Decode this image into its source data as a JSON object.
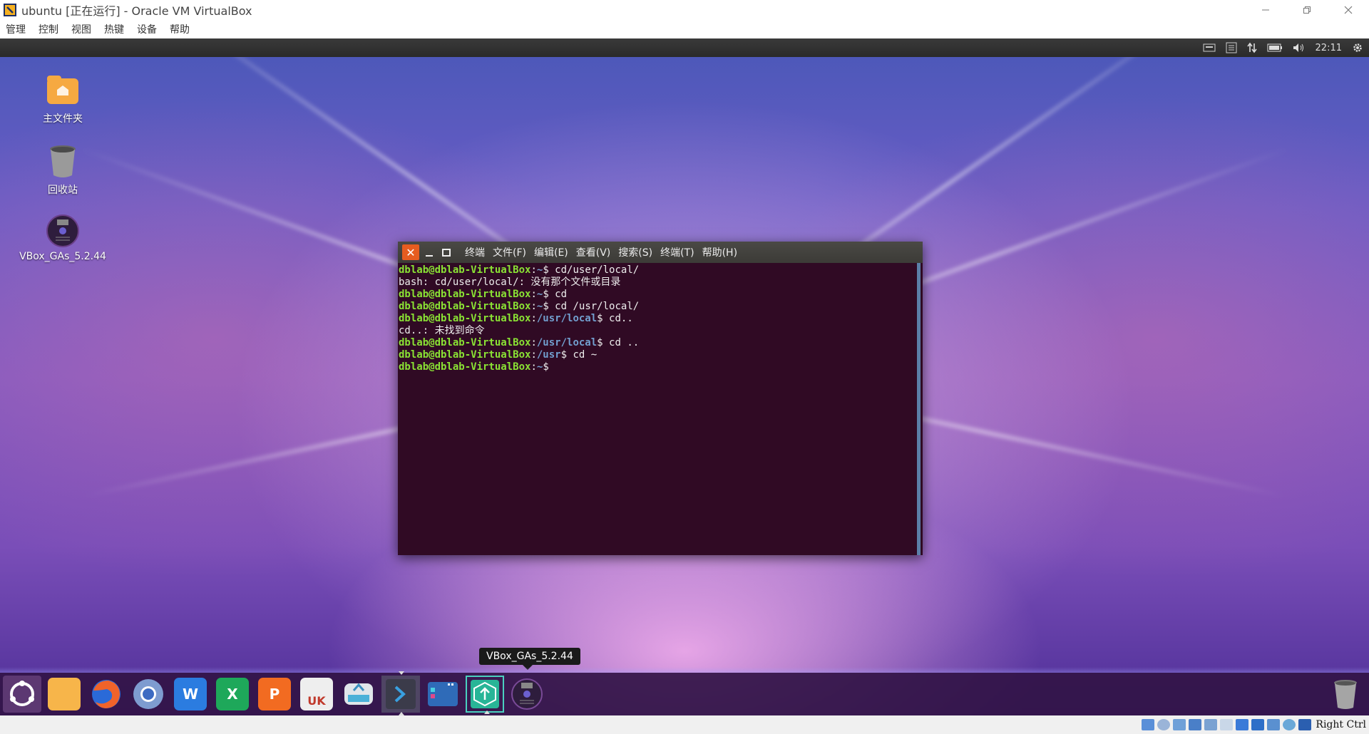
{
  "host": {
    "title": "ubuntu [正在运行] - Oracle VM VirtualBox",
    "menu": [
      "管理",
      "控制",
      "视图",
      "热键",
      "设备",
      "帮助"
    ],
    "host_key_label": "Right Ctrl"
  },
  "guest": {
    "topbar": {
      "time": "22:11"
    },
    "desktop_icons": [
      {
        "label": "主文件夹",
        "icon": "home-folder-icon"
      },
      {
        "label": "回收站",
        "icon": "trash-icon"
      },
      {
        "label": "VBox_GAs_5.2.44",
        "icon": "cd-icon"
      }
    ],
    "terminal": {
      "menus": [
        "终端",
        "文件(F)",
        "编辑(E)",
        "查看(V)",
        "搜索(S)",
        "终端(T)",
        "帮助(H)"
      ],
      "lines": [
        {
          "user": "dblab@dblab-VirtualBox",
          "path": "~",
          "cmd": "$ cd/user/local/"
        },
        {
          "text": "bash: cd/user/local/: 没有那个文件或目录"
        },
        {
          "user": "dblab@dblab-VirtualBox",
          "path": "~",
          "cmd": "$ cd"
        },
        {
          "user": "dblab@dblab-VirtualBox",
          "path": "~",
          "cmd": "$ cd /usr/local/"
        },
        {
          "user": "dblab@dblab-VirtualBox",
          "path": "/usr/local",
          "cmd": "$ cd.."
        },
        {
          "text": "cd..: 未找到命令"
        },
        {
          "user": "dblab@dblab-VirtualBox",
          "path": "/usr/local",
          "cmd": "$ cd .."
        },
        {
          "user": "dblab@dblab-VirtualBox",
          "path": "/usr",
          "cmd": "$ cd ~"
        },
        {
          "user": "dblab@dblab-VirtualBox",
          "path": "~",
          "cmd": "$"
        }
      ]
    },
    "dock": {
      "tooltip": "VBox_GAs_5.2.44",
      "items": [
        {
          "name": "ubuntu-launcher-icon",
          "color": "#6b3f78"
        },
        {
          "name": "files-folder-icon",
          "color": "#f7a43a"
        },
        {
          "name": "firefox-icon",
          "color": "#e6622a"
        },
        {
          "name": "chromium-icon",
          "color": "#5a7fbf"
        },
        {
          "name": "wps-writer-icon",
          "color": "#2b7ce0",
          "glyph": "W"
        },
        {
          "name": "wps-spreadsheet-icon",
          "color": "#1ea85a",
          "glyph": "X"
        },
        {
          "name": "wps-presentation-icon",
          "color": "#f26b21",
          "glyph": "P"
        },
        {
          "name": "ubuntu-software-icon",
          "color": "#e9e9e9",
          "glyph": "UK"
        },
        {
          "name": "backup-drive-icon",
          "color": "#cfd8dc"
        },
        {
          "name": "terminal-icon",
          "color": "#2d2d2d",
          "glyph": ">"
        },
        {
          "name": "workspace-switcher-icon",
          "color": "#3a6fb5"
        },
        {
          "name": "software-updater-icon",
          "color": "#2fb89a",
          "glyph": "↑"
        },
        {
          "name": "cd-icon",
          "color": "#3a2450"
        }
      ]
    }
  }
}
